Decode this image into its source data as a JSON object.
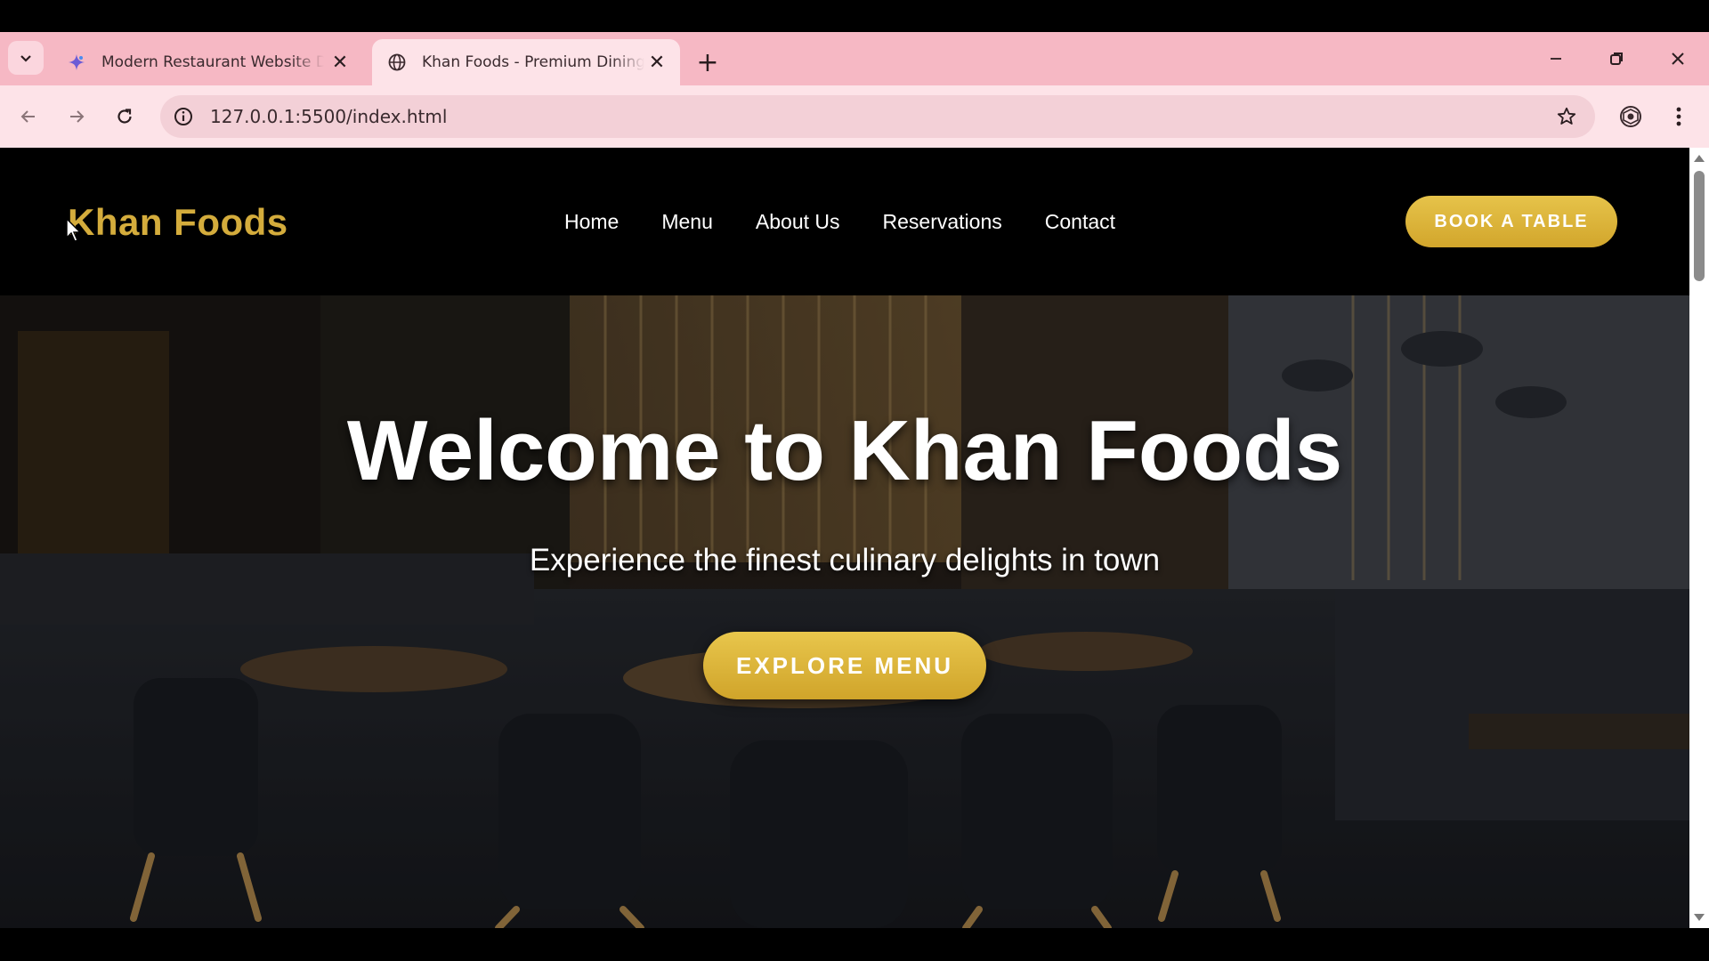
{
  "browser": {
    "tabs": [
      {
        "title": "Modern Restaurant Website Design",
        "favicon": "ai-spark-icon",
        "active": false
      },
      {
        "title": "Khan Foods - Premium Dining Experience",
        "favicon": "globe-icon",
        "active": true
      }
    ],
    "url": "127.0.0.1:5500/index.html",
    "new_tab_glyph": "+",
    "close_glyph": "✕"
  },
  "site": {
    "logo": "Khan Foods",
    "nav": [
      "Home",
      "Menu",
      "About Us",
      "Reservations",
      "Contact"
    ],
    "cta": "BOOK A TABLE",
    "hero": {
      "title": "Welcome to Khan Foods",
      "subtitle": "Experience the finest culinary delights in town",
      "button": "EXPLORE MENU"
    }
  },
  "colors": {
    "accent_gold": "#d4ac3c",
    "tabstrip": "#f6b8c4",
    "toolbar": "#fde3e8",
    "page_bg": "#000000"
  }
}
